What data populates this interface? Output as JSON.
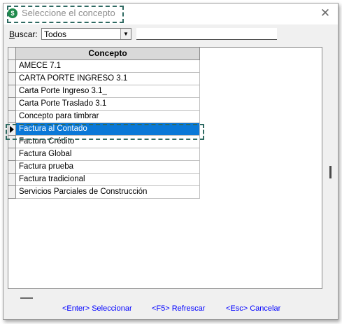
{
  "window": {
    "title": "Seleccione el concepto",
    "app_icon": "$",
    "close_glyph": "✕"
  },
  "search": {
    "label_underlined": "B",
    "label_rest": "uscar:",
    "filter_value": "Todos",
    "text_value": ""
  },
  "grid": {
    "column_header": "Concepto",
    "rows": [
      "AMECE 7.1",
      "CARTA PORTE INGRESO 3.1",
      "Carta Porte Ingreso 3.1_",
      "Carta Porte Traslado 3.1",
      "Concepto para timbrar",
      "Factura al Contado",
      "Factura Crédito",
      "Factura Global",
      "Factura prueba",
      "Factura tradicional",
      "Servicios Parciales de Construcción"
    ],
    "selected_index": 5
  },
  "status": {
    "enter": "<Enter> Seleccionar",
    "f5": "<F5> Refrescar",
    "esc": "<Esc> Cancelar"
  },
  "colors": {
    "selection": "#0a78d7",
    "highlight_dash": "#2f6a62",
    "status_text": "#0000ff"
  }
}
